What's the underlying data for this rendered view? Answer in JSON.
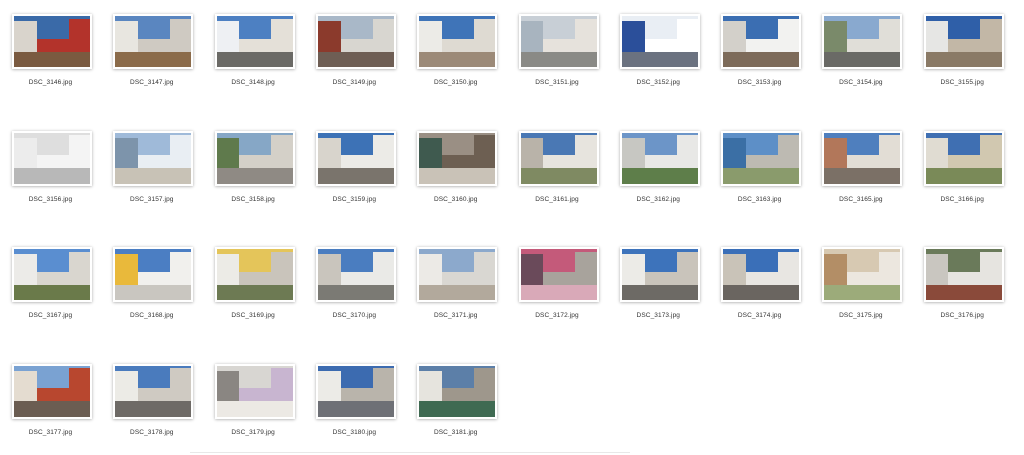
{
  "files": [
    {
      "name": "DSC_3146.jpg",
      "colors": [
        "#3a6aa8",
        "#d9d4cc",
        "#7a5a40",
        "#b3332b"
      ]
    },
    {
      "name": "DSC_3147.jpg",
      "colors": [
        "#5a86c0",
        "#e8e6e0",
        "#8b6b4a",
        "#cfcac2"
      ]
    },
    {
      "name": "DSC_3148.jpg",
      "colors": [
        "#4d80c2",
        "#eef0f3",
        "#6b6a66",
        "#e4e0d8"
      ]
    },
    {
      "name": "DSC_3149.jpg",
      "colors": [
        "#a9b8c8",
        "#8b3a2c",
        "#6e5e54",
        "#d8d6d0"
      ]
    },
    {
      "name": "DSC_3150.jpg",
      "colors": [
        "#3f74b8",
        "#ecebe7",
        "#9c8a78",
        "#dedad2"
      ]
    },
    {
      "name": "DSC_3151.jpg",
      "colors": [
        "#c8cfd6",
        "#a8b4bf",
        "#8a8a86",
        "#e6e2dc"
      ]
    },
    {
      "name": "DSC_3152.jpg",
      "colors": [
        "#e9eef4",
        "#2b4f9a",
        "#6b7280",
        "#ffffff"
      ]
    },
    {
      "name": "DSC_3153.jpg",
      "colors": [
        "#3b6eb2",
        "#d3d0ca",
        "#7d6b5a",
        "#f2f2f0"
      ]
    },
    {
      "name": "DSC_3154.jpg",
      "colors": [
        "#89a9cf",
        "#7a8a6a",
        "#6a6a66",
        "#e0ded8"
      ]
    },
    {
      "name": "DSC_3155.jpg",
      "colors": [
        "#2f5fa8",
        "#e6e6e4",
        "#8a7a66",
        "#c2b7a6"
      ]
    },
    {
      "name": "DSC_3156.jpg",
      "colors": [
        "#dedede",
        "#ececec",
        "#b8b8b8",
        "#f4f4f4"
      ]
    },
    {
      "name": "DSC_3157.jpg",
      "colors": [
        "#9fbad9",
        "#7d94ab",
        "#c8c2b6",
        "#e9eef3"
      ]
    },
    {
      "name": "DSC_3158.jpg",
      "colors": [
        "#86a7c6",
        "#5f7a4c",
        "#8f8a84",
        "#d4d0c8"
      ]
    },
    {
      "name": "DSC_3159.jpg",
      "colors": [
        "#3d72b6",
        "#d8d4cc",
        "#7a746c",
        "#ecebe7"
      ]
    },
    {
      "name": "DSC_3160.jpg",
      "colors": [
        "#9a8f84",
        "#3f5a4f",
        "#c9c2b7",
        "#6d5f52"
      ]
    },
    {
      "name": "DSC_3161.jpg",
      "colors": [
        "#4a78b4",
        "#b9b3a9",
        "#7f8a62",
        "#e7e4de"
      ]
    },
    {
      "name": "DSC_3162.jpg",
      "colors": [
        "#6c95c8",
        "#c7c7c2",
        "#5e7e4a",
        "#e8e8e6"
      ]
    },
    {
      "name": "DSC_3163.jpg",
      "colors": [
        "#5d8fc7",
        "#3b6fa5",
        "#8a9b6c",
        "#bdbab2"
      ]
    },
    {
      "name": "DSC_3165.jpg",
      "colors": [
        "#4f7fbe",
        "#b2775a",
        "#7b7066",
        "#e2ddd5"
      ]
    },
    {
      "name": "DSC_3166.jpg",
      "colors": [
        "#3f6fb2",
        "#e0dcd2",
        "#7a8a58",
        "#d1c8b0"
      ]
    },
    {
      "name": "DSC_3167.jpg",
      "colors": [
        "#5a8ed0",
        "#ecebe8",
        "#6a7a4a",
        "#d9d6cf"
      ]
    },
    {
      "name": "DSC_3168.jpg",
      "colors": [
        "#4b7ec3",
        "#e9b93b",
        "#c9c6c0",
        "#f1f0ed"
      ]
    },
    {
      "name": "DSC_3169.jpg",
      "colors": [
        "#e4c55a",
        "#ecebe6",
        "#6d7a53",
        "#c9c4bb"
      ]
    },
    {
      "name": "DSC_3170.jpg",
      "colors": [
        "#4a7dc0",
        "#c9c5bd",
        "#7b7a74",
        "#eaeae7"
      ]
    },
    {
      "name": "DSC_3171.jpg",
      "colors": [
        "#8ca9cc",
        "#eceae6",
        "#b2a99c",
        "#d9d7d2"
      ]
    },
    {
      "name": "DSC_3172.jpg",
      "colors": [
        "#c45a7a",
        "#6a4a5a",
        "#d9a9b8",
        "#a8a39c"
      ]
    },
    {
      "name": "DSC_3173.jpg",
      "colors": [
        "#3d73bb",
        "#ecebe7",
        "#6d6a65",
        "#c9c4bb"
      ]
    },
    {
      "name": "DSC_3174.jpg",
      "colors": [
        "#3a6fb8",
        "#c9c3b8",
        "#6a6560",
        "#e8e6e2"
      ]
    },
    {
      "name": "DSC_3175.jpg",
      "colors": [
        "#d7c9b2",
        "#b38e66",
        "#9cab7a",
        "#ece7df"
      ]
    },
    {
      "name": "DSC_3176.jpg",
      "colors": [
        "#6a7a5a",
        "#c9c6c0",
        "#8a4a3a",
        "#e6e4e0"
      ]
    },
    {
      "name": "DSC_3177.jpg",
      "colors": [
        "#7aa2d2",
        "#e4dcd0",
        "#6b5d52",
        "#b8472f"
      ]
    },
    {
      "name": "DSC_3178.jpg",
      "colors": [
        "#4a7bbd",
        "#ecebe6",
        "#6e6a66",
        "#cfcac2"
      ]
    },
    {
      "name": "DSC_3179.jpg",
      "colors": [
        "#d8d6d2",
        "#8a8682",
        "#ece9e4",
        "#c8b5d0"
      ]
    },
    {
      "name": "DSC_3180.jpg",
      "colors": [
        "#3c6bb0",
        "#ecebe7",
        "#6e7076",
        "#b9b4ab"
      ]
    },
    {
      "name": "DSC_3181.jpg",
      "colors": [
        "#5c7fa8",
        "#e6e4de",
        "#3f6a52",
        "#9e978c"
      ]
    }
  ]
}
